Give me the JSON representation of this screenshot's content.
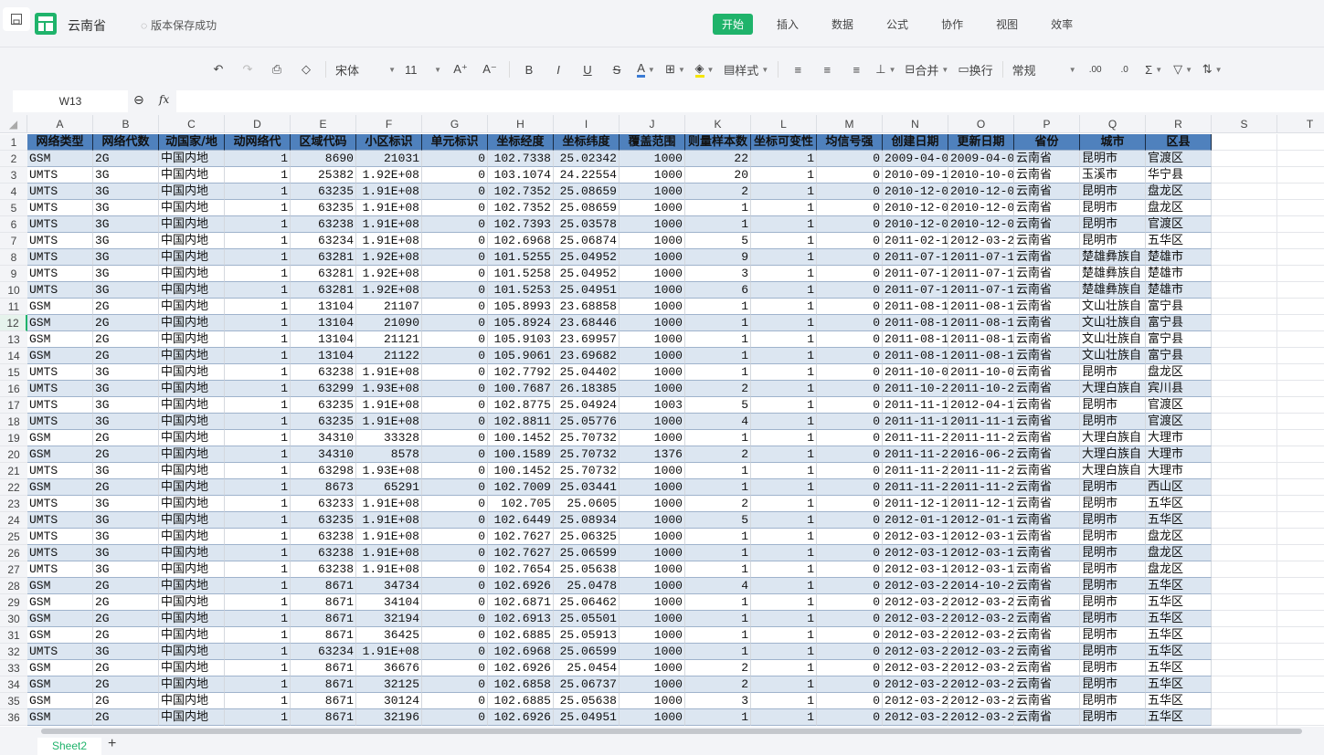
{
  "app": {
    "doc_title": "云南省",
    "save_status": "版本保存成功"
  },
  "menu": [
    {
      "label": "开始",
      "active": true
    },
    {
      "label": "插入"
    },
    {
      "label": "数据"
    },
    {
      "label": "公式"
    },
    {
      "label": "协作"
    },
    {
      "label": "视图"
    },
    {
      "label": "效率"
    }
  ],
  "toolbar": {
    "font": "宋体",
    "size": "11",
    "style_label": "样式",
    "merge_label": "合并",
    "wrap_label": "换行",
    "format": "常规",
    "font_color": "#3a7bd5",
    "fill_color": "#f5e600"
  },
  "formula_bar": {
    "cell_ref": "W13",
    "formula": ""
  },
  "columns": [
    "A",
    "B",
    "C",
    "D",
    "E",
    "F",
    "G",
    "H",
    "I",
    "J",
    "K",
    "L",
    "M",
    "N",
    "O",
    "P",
    "Q",
    "R",
    "S",
    "T"
  ],
  "numeric_columns": [
    3,
    4,
    5,
    6,
    7,
    8,
    9,
    10,
    11,
    12
  ],
  "header_row": [
    "网络类型",
    "网络代数",
    "动国家/地",
    "动网络代",
    "区域代码",
    "小区标识",
    "单元标识",
    "坐标经度",
    "坐标纬度",
    "覆盖范围",
    "则量样本数",
    "坐标可变性",
    "均信号强",
    "创建日期",
    "更新日期",
    "省份",
    "城市",
    "区县"
  ],
  "rows": [
    [
      "GSM",
      "2G",
      "中国内地",
      "1",
      "8690",
      "21031",
      "0",
      "102.7338",
      "25.02342",
      "1000",
      "22",
      "1",
      "0",
      "2009-04-0",
      "2009-04-0",
      "云南省",
      "昆明市",
      "官渡区"
    ],
    [
      "UMTS",
      "3G",
      "中国内地",
      "1",
      "25382",
      "1.92E+08",
      "0",
      "103.1074",
      "24.22554",
      "1000",
      "20",
      "1",
      "0",
      "2010-09-1",
      "2010-10-0",
      "云南省",
      "玉溪市",
      "华宁县"
    ],
    [
      "UMTS",
      "3G",
      "中国内地",
      "1",
      "63235",
      "1.91E+08",
      "0",
      "102.7352",
      "25.08659",
      "1000",
      "2",
      "1",
      "0",
      "2010-12-0",
      "2010-12-0",
      "云南省",
      "昆明市",
      "盘龙区"
    ],
    [
      "UMTS",
      "3G",
      "中国内地",
      "1",
      "63235",
      "1.91E+08",
      "0",
      "102.7352",
      "25.08659",
      "1000",
      "1",
      "1",
      "0",
      "2010-12-0",
      "2010-12-0",
      "云南省",
      "昆明市",
      "盘龙区"
    ],
    [
      "UMTS",
      "3G",
      "中国内地",
      "1",
      "63238",
      "1.91E+08",
      "0",
      "102.7393",
      "25.03578",
      "1000",
      "1",
      "1",
      "0",
      "2010-12-0",
      "2010-12-0",
      "云南省",
      "昆明市",
      "官渡区"
    ],
    [
      "UMTS",
      "3G",
      "中国内地",
      "1",
      "63234",
      "1.91E+08",
      "0",
      "102.6968",
      "25.06874",
      "1000",
      "5",
      "1",
      "0",
      "2011-02-1",
      "2012-03-2",
      "云南省",
      "昆明市",
      "五华区"
    ],
    [
      "UMTS",
      "3G",
      "中国内地",
      "1",
      "63281",
      "1.92E+08",
      "0",
      "101.5255",
      "25.04952",
      "1000",
      "9",
      "1",
      "0",
      "2011-07-1",
      "2011-07-1",
      "云南省",
      "楚雄彝族自",
      "楚雄市"
    ],
    [
      "UMTS",
      "3G",
      "中国内地",
      "1",
      "63281",
      "1.92E+08",
      "0",
      "101.5258",
      "25.04952",
      "1000",
      "3",
      "1",
      "0",
      "2011-07-1",
      "2011-07-1",
      "云南省",
      "楚雄彝族自",
      "楚雄市"
    ],
    [
      "UMTS",
      "3G",
      "中国内地",
      "1",
      "63281",
      "1.92E+08",
      "0",
      "101.5253",
      "25.04951",
      "1000",
      "6",
      "1",
      "0",
      "2011-07-1",
      "2011-07-1",
      "云南省",
      "楚雄彝族自",
      "楚雄市"
    ],
    [
      "GSM",
      "2G",
      "中国内地",
      "1",
      "13104",
      "21107",
      "0",
      "105.8993",
      "23.68858",
      "1000",
      "1",
      "1",
      "0",
      "2011-08-1",
      "2011-08-1",
      "云南省",
      "文山壮族自",
      "富宁县"
    ],
    [
      "GSM",
      "2G",
      "中国内地",
      "1",
      "13104",
      "21090",
      "0",
      "105.8924",
      "23.68446",
      "1000",
      "1",
      "1",
      "0",
      "2011-08-1",
      "2011-08-1",
      "云南省",
      "文山壮族自",
      "富宁县"
    ],
    [
      "GSM",
      "2G",
      "中国内地",
      "1",
      "13104",
      "21121",
      "0",
      "105.9103",
      "23.69957",
      "1000",
      "1",
      "1",
      "0",
      "2011-08-1",
      "2011-08-1",
      "云南省",
      "文山壮族自",
      "富宁县"
    ],
    [
      "GSM",
      "2G",
      "中国内地",
      "1",
      "13104",
      "21122",
      "0",
      "105.9061",
      "23.69682",
      "1000",
      "1",
      "1",
      "0",
      "2011-08-1",
      "2011-08-1",
      "云南省",
      "文山壮族自",
      "富宁县"
    ],
    [
      "UMTS",
      "3G",
      "中国内地",
      "1",
      "63238",
      "1.91E+08",
      "0",
      "102.7792",
      "25.04402",
      "1000",
      "1",
      "1",
      "0",
      "2011-10-0",
      "2011-10-0",
      "云南省",
      "昆明市",
      "盘龙区"
    ],
    [
      "UMTS",
      "3G",
      "中国内地",
      "1",
      "63299",
      "1.93E+08",
      "0",
      "100.7687",
      "26.18385",
      "1000",
      "2",
      "1",
      "0",
      "2011-10-2",
      "2011-10-2",
      "云南省",
      "大理白族自",
      "宾川县"
    ],
    [
      "UMTS",
      "3G",
      "中国内地",
      "1",
      "63235",
      "1.91E+08",
      "0",
      "102.8775",
      "25.04924",
      "1003",
      "5",
      "1",
      "0",
      "2011-11-1",
      "2012-04-1",
      "云南省",
      "昆明市",
      "官渡区"
    ],
    [
      "UMTS",
      "3G",
      "中国内地",
      "1",
      "63235",
      "1.91E+08",
      "0",
      "102.8811",
      "25.05776",
      "1000",
      "4",
      "1",
      "0",
      "2011-11-1",
      "2011-11-1",
      "云南省",
      "昆明市",
      "官渡区"
    ],
    [
      "GSM",
      "2G",
      "中国内地",
      "1",
      "34310",
      "33328",
      "0",
      "100.1452",
      "25.70732",
      "1000",
      "1",
      "1",
      "0",
      "2011-11-2",
      "2011-11-2",
      "云南省",
      "大理白族自",
      "大理市"
    ],
    [
      "GSM",
      "2G",
      "中国内地",
      "1",
      "34310",
      "8578",
      "0",
      "100.1589",
      "25.70732",
      "1376",
      "2",
      "1",
      "0",
      "2011-11-2",
      "2016-06-2",
      "云南省",
      "大理白族自",
      "大理市"
    ],
    [
      "UMTS",
      "3G",
      "中国内地",
      "1",
      "63298",
      "1.93E+08",
      "0",
      "100.1452",
      "25.70732",
      "1000",
      "1",
      "1",
      "0",
      "2011-11-2",
      "2011-11-2",
      "云南省",
      "大理白族自",
      "大理市"
    ],
    [
      "GSM",
      "2G",
      "中国内地",
      "1",
      "8673",
      "65291",
      "0",
      "102.7009",
      "25.03441",
      "1000",
      "1",
      "1",
      "0",
      "2011-11-2",
      "2011-11-2",
      "云南省",
      "昆明市",
      "西山区"
    ],
    [
      "UMTS",
      "3G",
      "中国内地",
      "1",
      "63233",
      "1.91E+08",
      "0",
      "102.705",
      "25.0605",
      "1000",
      "2",
      "1",
      "0",
      "2011-12-1",
      "2011-12-1",
      "云南省",
      "昆明市",
      "五华区"
    ],
    [
      "UMTS",
      "3G",
      "中国内地",
      "1",
      "63235",
      "1.91E+08",
      "0",
      "102.6449",
      "25.08934",
      "1000",
      "5",
      "1",
      "0",
      "2012-01-1",
      "2012-01-1",
      "云南省",
      "昆明市",
      "五华区"
    ],
    [
      "UMTS",
      "3G",
      "中国内地",
      "1",
      "63238",
      "1.91E+08",
      "0",
      "102.7627",
      "25.06325",
      "1000",
      "1",
      "1",
      "0",
      "2012-03-1",
      "2012-03-1",
      "云南省",
      "昆明市",
      "盘龙区"
    ],
    [
      "UMTS",
      "3G",
      "中国内地",
      "1",
      "63238",
      "1.91E+08",
      "0",
      "102.7627",
      "25.06599",
      "1000",
      "1",
      "1",
      "0",
      "2012-03-1",
      "2012-03-1",
      "云南省",
      "昆明市",
      "盘龙区"
    ],
    [
      "UMTS",
      "3G",
      "中国内地",
      "1",
      "63238",
      "1.91E+08",
      "0",
      "102.7654",
      "25.05638",
      "1000",
      "1",
      "1",
      "0",
      "2012-03-1",
      "2012-03-1",
      "云南省",
      "昆明市",
      "盘龙区"
    ],
    [
      "GSM",
      "2G",
      "中国内地",
      "1",
      "8671",
      "34734",
      "0",
      "102.6926",
      "25.0478",
      "1000",
      "4",
      "1",
      "0",
      "2012-03-2",
      "2014-10-2",
      "云南省",
      "昆明市",
      "五华区"
    ],
    [
      "GSM",
      "2G",
      "中国内地",
      "1",
      "8671",
      "34104",
      "0",
      "102.6871",
      "25.06462",
      "1000",
      "1",
      "1",
      "0",
      "2012-03-2",
      "2012-03-2",
      "云南省",
      "昆明市",
      "五华区"
    ],
    [
      "GSM",
      "2G",
      "中国内地",
      "1",
      "8671",
      "32194",
      "0",
      "102.6913",
      "25.05501",
      "1000",
      "1",
      "1",
      "0",
      "2012-03-2",
      "2012-03-2",
      "云南省",
      "昆明市",
      "五华区"
    ],
    [
      "GSM",
      "2G",
      "中国内地",
      "1",
      "8671",
      "36425",
      "0",
      "102.6885",
      "25.05913",
      "1000",
      "1",
      "1",
      "0",
      "2012-03-2",
      "2012-03-2",
      "云南省",
      "昆明市",
      "五华区"
    ],
    [
      "UMTS",
      "3G",
      "中国内地",
      "1",
      "63234",
      "1.91E+08",
      "0",
      "102.6968",
      "25.06599",
      "1000",
      "1",
      "1",
      "0",
      "2012-03-2",
      "2012-03-2",
      "云南省",
      "昆明市",
      "五华区"
    ],
    [
      "GSM",
      "2G",
      "中国内地",
      "1",
      "8671",
      "36676",
      "0",
      "102.6926",
      "25.0454",
      "1000",
      "2",
      "1",
      "0",
      "2012-03-2",
      "2012-03-2",
      "云南省",
      "昆明市",
      "五华区"
    ],
    [
      "GSM",
      "2G",
      "中国内地",
      "1",
      "8671",
      "32125",
      "0",
      "102.6858",
      "25.06737",
      "1000",
      "2",
      "1",
      "0",
      "2012-03-2",
      "2012-03-2",
      "云南省",
      "昆明市",
      "五华区"
    ],
    [
      "GSM",
      "2G",
      "中国内地",
      "1",
      "8671",
      "30124",
      "0",
      "102.6885",
      "25.05638",
      "1000",
      "3",
      "1",
      "0",
      "2012-03-2",
      "2012-03-2",
      "云南省",
      "昆明市",
      "五华区"
    ],
    [
      "GSM",
      "2G",
      "中国内地",
      "1",
      "8671",
      "32196",
      "0",
      "102.6926",
      "25.04951",
      "1000",
      "1",
      "1",
      "0",
      "2012-03-2",
      "2012-03-2",
      "云南省",
      "昆明市",
      "五华区"
    ]
  ],
  "sheets": [
    {
      "label": "Sheet2",
      "active": true
    }
  ],
  "add_sheet": "+"
}
